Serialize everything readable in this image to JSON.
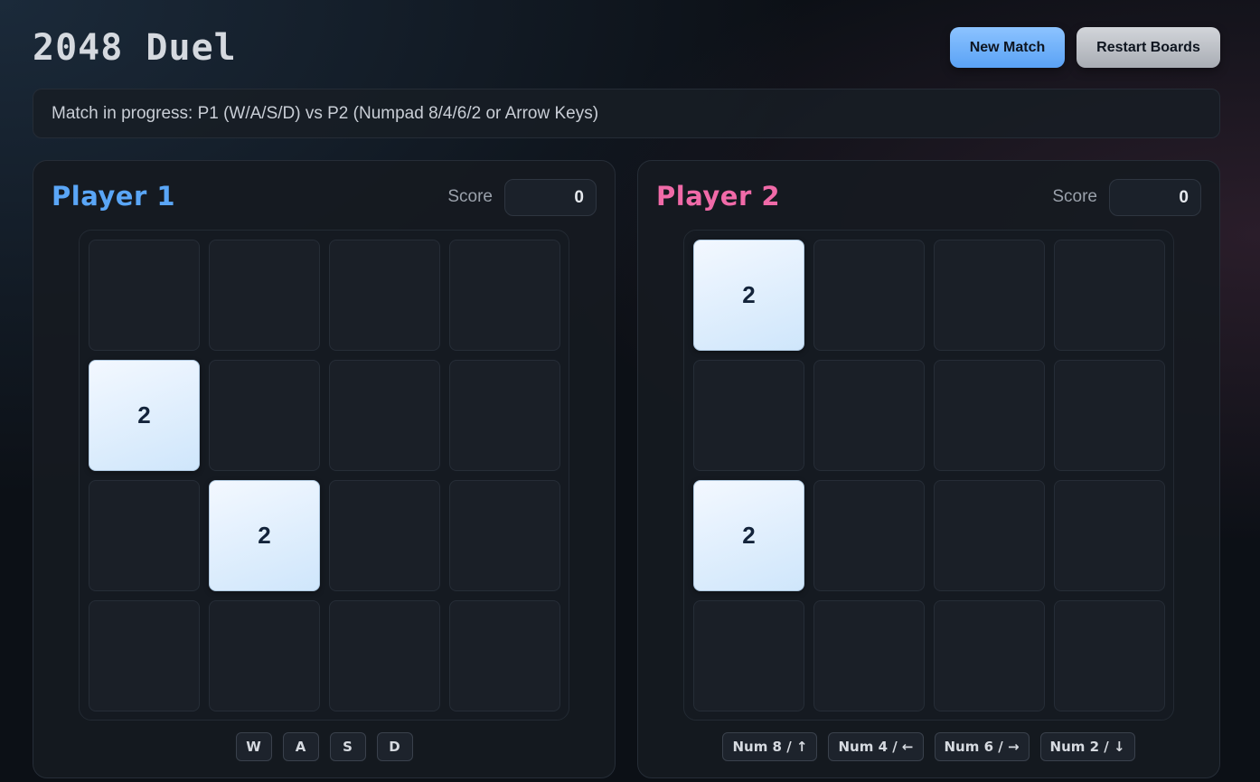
{
  "header": {
    "title": "2048 Duel",
    "new_match_label": "New Match",
    "restart_label": "Restart Boards"
  },
  "status": "Match in progress: P1 (W/A/S/D) vs P2 (Numpad 8/4/6/2 or Arrow Keys)",
  "players": [
    {
      "name": "Player 1",
      "score_label": "Score",
      "score": "0",
      "accent": "#5aa6f7",
      "tiles": [
        {
          "row": 1,
          "col": 0,
          "value": "2"
        },
        {
          "row": 2,
          "col": 1,
          "value": "2"
        }
      ],
      "keys": [
        "W",
        "A",
        "S",
        "D"
      ]
    },
    {
      "name": "Player 2",
      "score_label": "Score",
      "score": "0",
      "accent": "#f06aa8",
      "tiles": [
        {
          "row": 0,
          "col": 0,
          "value": "2"
        },
        {
          "row": 2,
          "col": 0,
          "value": "2"
        }
      ],
      "keys": [
        "Num 8 / ↑",
        "Num 4 / ←",
        "Num 6 / →",
        "Num 2 / ↓"
      ]
    }
  ],
  "grid_size": 4
}
